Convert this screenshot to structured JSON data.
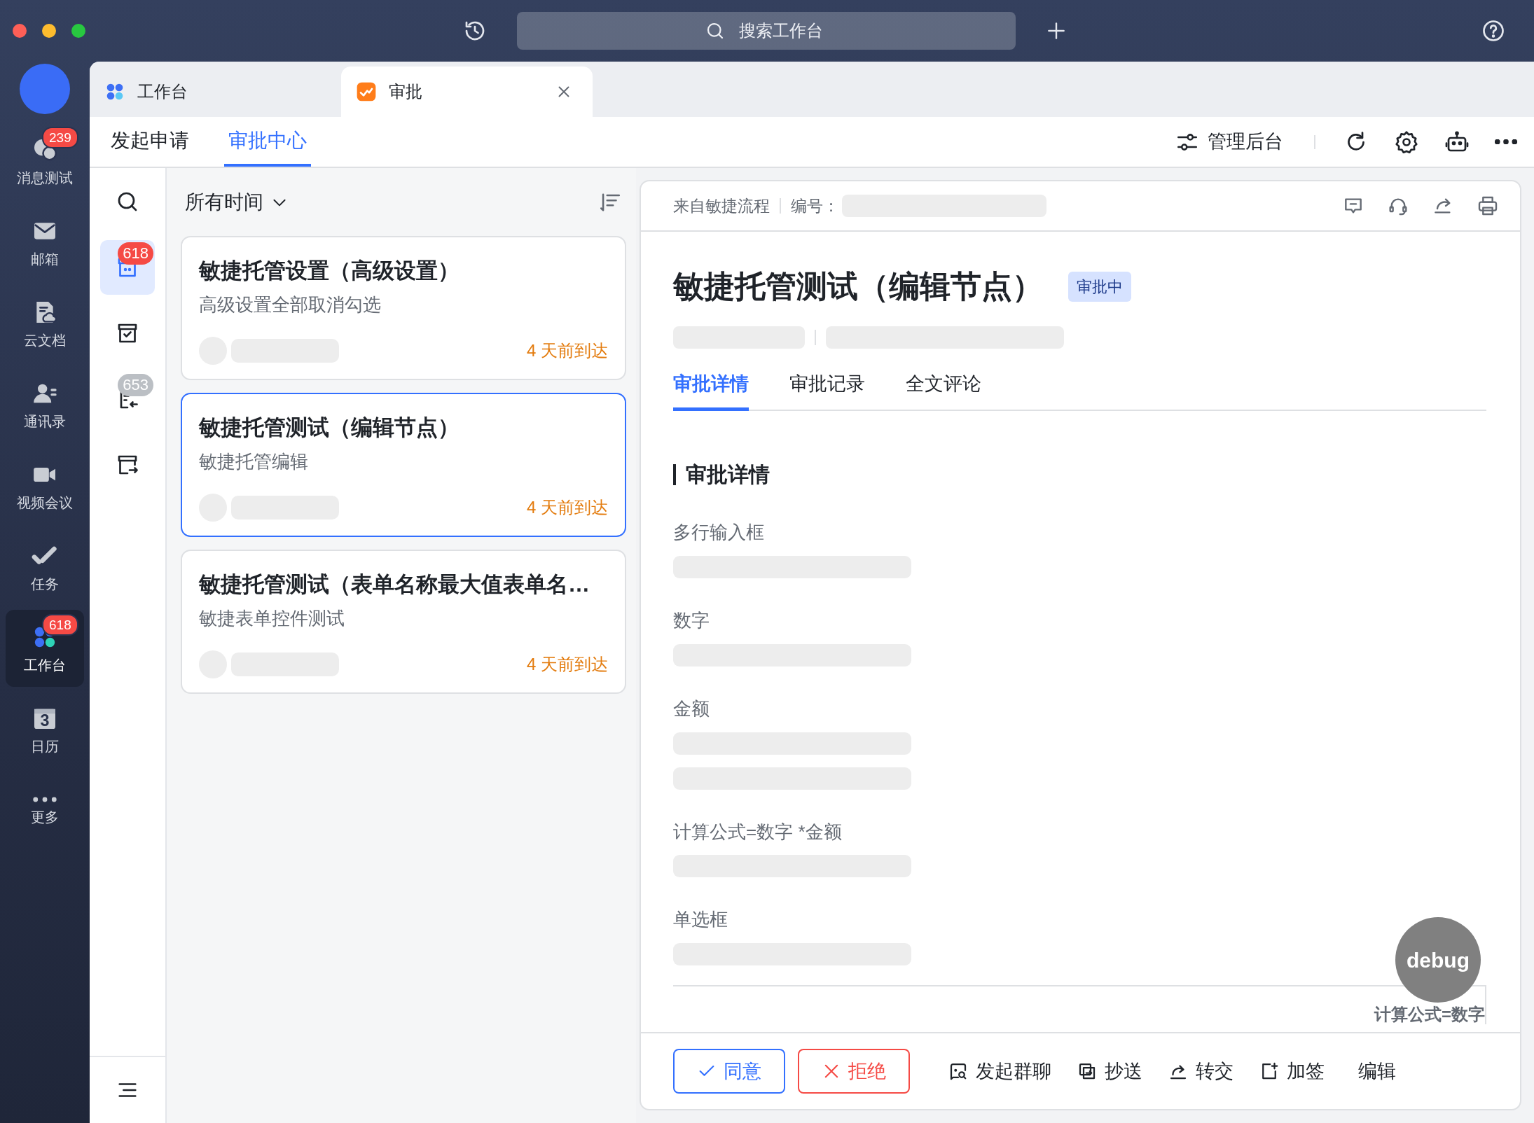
{
  "topbar": {
    "search": {
      "placeholder": "搜索工作台"
    }
  },
  "sidebar": {
    "items": [
      {
        "label": "消息测试",
        "badge": "239",
        "selected": false
      },
      {
        "label": "邮箱",
        "selected": false
      },
      {
        "label": "云文档",
        "selected": false
      },
      {
        "label": "通讯录",
        "selected": false
      },
      {
        "label": "视频会议",
        "selected": false
      },
      {
        "label": "任务",
        "selected": false
      },
      {
        "label": "工作台",
        "badge": "618",
        "selected": true
      },
      {
        "label": "日历",
        "icon_text": "3",
        "selected": false
      },
      {
        "label": "更多",
        "selected": false
      }
    ]
  },
  "app_tabs": [
    {
      "label": "工作台",
      "selected": false
    },
    {
      "label": "审批",
      "selected": true
    }
  ],
  "subnav": {
    "tabs": [
      {
        "label": "发起申请",
        "selected": false
      },
      {
        "label": "审批中心",
        "selected": true
      }
    ],
    "admin": "管理后台"
  },
  "rail": {
    "items": [
      {
        "selected": false
      },
      {
        "selected": true,
        "badge": {
          "text": "618",
          "color": "#f54a45"
        }
      },
      {
        "selected": false
      },
      {
        "selected": false,
        "badge": {
          "text": "653",
          "color": "#bbbfc4"
        }
      },
      {
        "selected": false
      }
    ]
  },
  "list": {
    "filter": "所有时间",
    "cards": [
      {
        "title": "敏捷托管设置（高级设置）",
        "subtitle": "高级设置全部取消勾选",
        "time": "4 天前到达",
        "selected": false
      },
      {
        "title": "敏捷托管测试（编辑节点）",
        "subtitle": "敏捷托管编辑",
        "time": "4 天前到达",
        "selected": true
      },
      {
        "title": "敏捷托管测试（表单名称最大值表单名…",
        "subtitle": "敏捷表单控件测试",
        "time": "4 天前到达",
        "selected": false
      }
    ]
  },
  "detail": {
    "source": "来自敏捷流程",
    "number_label": "编号：",
    "title": "敏捷托管测试（编辑节点）",
    "status": "审批中",
    "tabs": [
      {
        "label": "审批详情",
        "selected": true
      },
      {
        "label": "审批记录",
        "selected": false
      },
      {
        "label": "全文评论",
        "selected": false
      }
    ],
    "section": "审批详情",
    "fields": [
      {
        "label": "多行输入框",
        "values": [
          {
            "kind": "skeleton"
          }
        ]
      },
      {
        "label": "数字",
        "values": [
          {
            "kind": "skeleton"
          }
        ]
      },
      {
        "label": "金额",
        "values": [
          {
            "kind": "skeleton"
          },
          {
            "kind": "skeleton"
          }
        ]
      },
      {
        "label": "计算公式=数字 *金额",
        "values": [
          {
            "kind": "skeleton"
          }
        ]
      },
      {
        "label": "单选框",
        "values": [
          {
            "kind": "skeleton"
          }
        ]
      }
    ],
    "table_caption": "计算公式=数字"
  },
  "debug": "debug",
  "actions": [
    {
      "kind": "approve",
      "label": "同意"
    },
    {
      "kind": "reject",
      "label": "拒绝"
    },
    {
      "kind": "action",
      "label": "发起群聊"
    },
    {
      "kind": "action",
      "label": "抄送"
    },
    {
      "kind": "action",
      "label": "转交"
    },
    {
      "kind": "action",
      "label": "加签"
    },
    {
      "kind": "text",
      "label": "编辑"
    }
  ]
}
